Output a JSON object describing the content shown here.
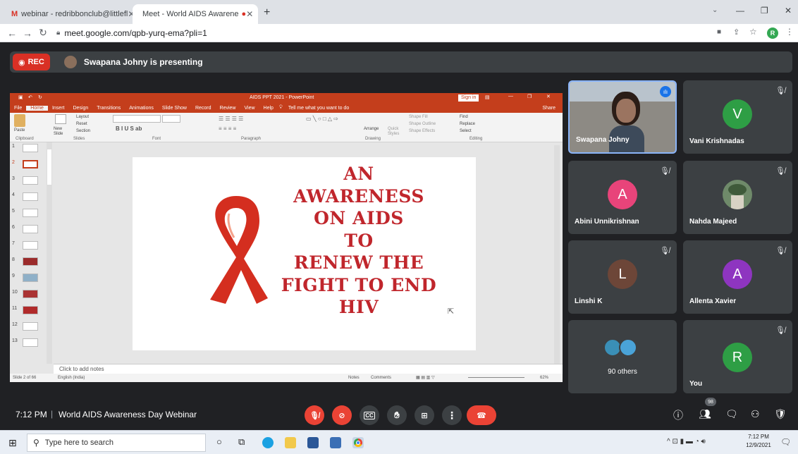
{
  "browser": {
    "tabs": [
      {
        "label": "webinar - redribbonclub@littlefl",
        "icon": "gmail-icon",
        "active": false
      },
      {
        "label": "Meet - World AIDS Awarene",
        "icon": "meet-icon",
        "active": true
      }
    ],
    "new_tab": "+",
    "url": "meet.google.com/qpb-yurq-ema?pli=1",
    "profile_initial": "R"
  },
  "meet": {
    "rec_label": "REC",
    "presenting_text": "Swapana Johny is presenting",
    "time": "7:12 PM",
    "meeting_title": "World AIDS Awareness Day Webinar",
    "participants_count": "98",
    "participants": [
      {
        "name": "Swapana Johny",
        "type": "video",
        "speaking": true
      },
      {
        "name": "Vani Krishnadas",
        "initial": "V",
        "color": "#2e9e45",
        "muted": true
      },
      {
        "name": "Abini Unnikrishnan",
        "initial": "A",
        "color": "#e8447a",
        "muted": true
      },
      {
        "name": "Nahda Majeed",
        "type": "photo",
        "muted": true
      },
      {
        "name": "Linshi K",
        "initial": "L",
        "color": "#6d4638",
        "muted": true
      },
      {
        "name": "Allenta Xavier",
        "initial": "A",
        "color": "#8e35c0",
        "muted": true
      },
      {
        "name": "90 others",
        "type": "others"
      },
      {
        "name": "You",
        "initial": "R",
        "color": "#2e9e45",
        "muted": true
      }
    ],
    "cc_label": "CC"
  },
  "ppt": {
    "window_title": "AIDS PPT 2021 - PowerPoint",
    "sign_in": "Sign in",
    "ribbon_tabs": [
      "File",
      "Home",
      "Insert",
      "Design",
      "Transitions",
      "Animations",
      "Slide Show",
      "Record",
      "Review",
      "View",
      "Help"
    ],
    "tell_me": "Tell me what you want to do",
    "share": "Share",
    "ribbon": {
      "paste": "Paste",
      "new_slide": "New Slide",
      "layout": "Layout",
      "reset": "Reset",
      "section": "Section",
      "arrange": "Arrange",
      "quick_styles": "Quick Styles",
      "shape_fill": "Shape Fill",
      "shape_outline": "Shape Outline",
      "shape_effects": "Shape Effects",
      "find": "Find",
      "replace": "Replace",
      "select": "Select",
      "groups": [
        "Clipboard",
        "Slides",
        "Font",
        "Paragraph",
        "Drawing",
        "Editing"
      ]
    },
    "slide_numbers": [
      "1",
      "2",
      "3",
      "4",
      "5",
      "6",
      "7",
      "8",
      "9",
      "10",
      "11",
      "12",
      "13"
    ],
    "slide_title": [
      "AN",
      "AWARENESS",
      "ON AIDS",
      "TO",
      "RENEW THE",
      "FIGHT TO END",
      "HIV"
    ],
    "notes_placeholder": "Click to add notes",
    "status_slide": "Slide 2 of 66",
    "status_lang": "English (India)",
    "status_notes": "Notes",
    "status_comments": "Comments",
    "zoom": "62%"
  },
  "taskbar": {
    "search_placeholder": "Type here to search",
    "time": "7:12 PM",
    "date": "12/9/2021"
  }
}
